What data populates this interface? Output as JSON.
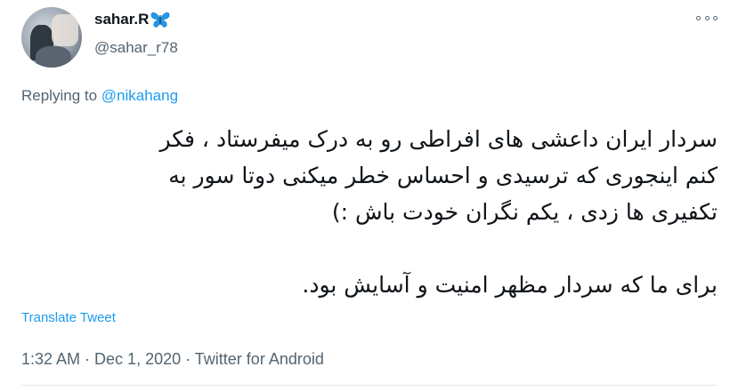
{
  "author": {
    "display_name": "sahar.R",
    "display_name_icon": "butterfly-icon",
    "handle": "@sahar_r78"
  },
  "reply": {
    "prefix": "Replying to ",
    "mention": "@nikahang"
  },
  "tweet": {
    "text": "سردار ایران داعشی های افراطی رو به درک میفرستاد ، فکر کنم اینجوری که ترسیدی و احساس خطر میکنی دوتا سور به تکفیری ها زدی ، یکم نگران خودت باش :)\n\nبرای ما که سردار مظهر امنیت و آسایش بود."
  },
  "translate_label": "Translate Tweet",
  "meta": {
    "time": "1:32 AM",
    "separator": " · ",
    "date": "Dec 1, 2020",
    "source": "Twitter for Android"
  },
  "colors": {
    "accent": "#1d9bf0",
    "secondary_text": "#536471",
    "butterfly": "#1d9bf0"
  },
  "icons": {
    "more": "more-icon"
  }
}
